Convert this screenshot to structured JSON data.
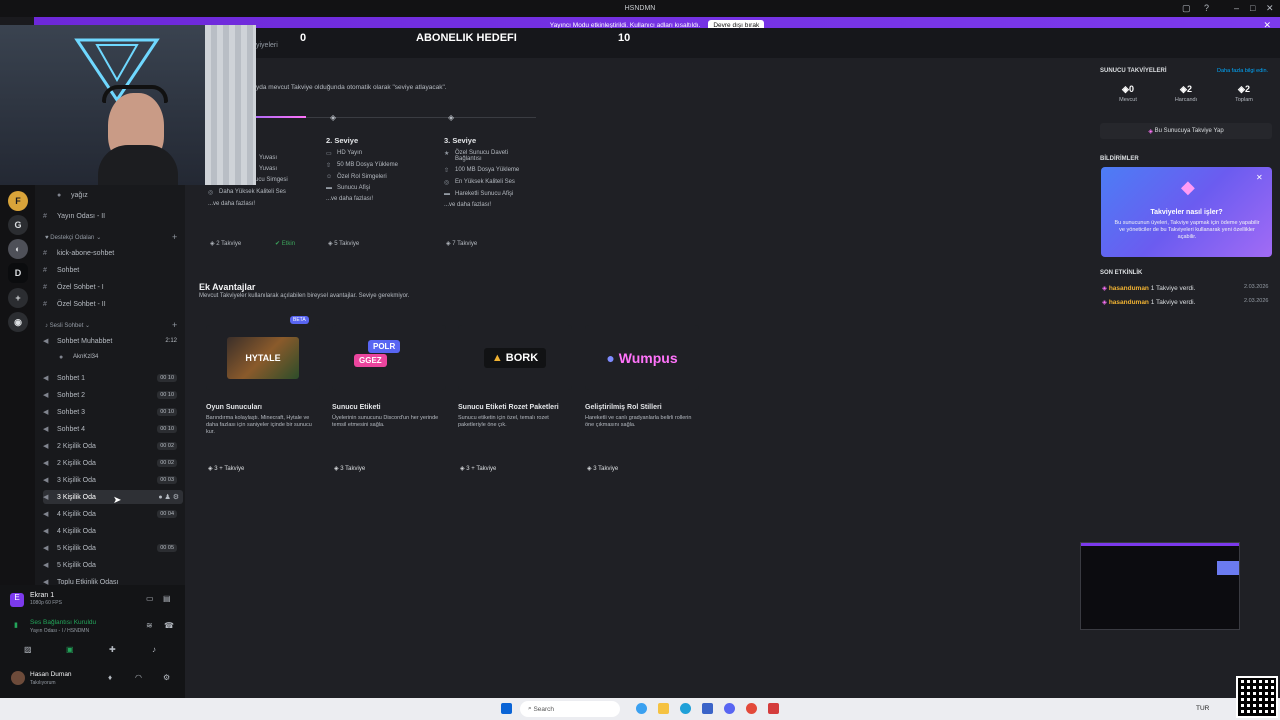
{
  "window": {
    "title": "HSNDMN"
  },
  "streamer_bar": {
    "message": "Yayıncı Modu etkinleştirildi. Kullanıcı adları kısaltıldı.",
    "button": "Devre dışı bırak"
  },
  "goal": {
    "left": "0",
    "title": "ABONELIK HEDEFI",
    "right": "10"
  },
  "header": {
    "partial_title": "yiyeleri",
    "note": "yda mevcut Takviye olduğunda otomatik olarak \"seviye atlayacak\"."
  },
  "tiers": [
    {
      "title": "",
      "items": [
        "Yuvası",
        "Yuvası",
        "Hareketli Sunucu Simgesi",
        "Daha Yüksek Kaliteli Ses",
        "...ve daha fazlası!"
      ],
      "cost": "2 Takviye",
      "status": "Etkin"
    },
    {
      "title": "2. Seviye",
      "items": [
        "HD Yayın",
        "50 MB Dosya Yükleme",
        "Özel Rol Simgeleri",
        "Sunucu Afişi",
        "...ve daha fazlası!"
      ],
      "cost": "5 Takviye"
    },
    {
      "title": "3. Seviye",
      "items": [
        "Özel Sunucu Daveti Bağlantısı",
        "100 MB Dosya Yükleme",
        "En Yüksek Kaliteli Ses",
        "Hareketli Sunucu Afişi",
        "...ve daha fazlası!"
      ],
      "cost": "7 Takviye"
    }
  ],
  "extra": {
    "title": "Ek Avantajlar",
    "subtitle": "Mevcut Takviyeler kullanılarak açılabilen bireysel avantajlar. Seviye gerekmiyor.",
    "beta": "BETA",
    "perks": [
      {
        "name": "Oyun Sunucuları",
        "desc": "Barındırma kolaylaştı. Minecraft, Hytale ve daha fazlası için saniyeler içinde bir sunucu kur.",
        "cost": "3 + Takviye",
        "art": "HYTALE"
      },
      {
        "name": "Sunucu Etiketi",
        "desc": "Üyelerinin sunucunu Discord'un her yerinde temsil etmesini sağla.",
        "cost": "3 Takviye",
        "art": "POLR",
        "art2": "GGEZ"
      },
      {
        "name": "Sunucu Etiketi Rozet Paketleri",
        "desc": "Sunucu etiketin için özel, temalı rozet paketleriyle öne çık.",
        "cost": "3 + Takviye",
        "art": "BORK"
      },
      {
        "name": "Geliştirilmiş Rol Stilleri",
        "desc": "Hareketli ve canlı gradyanlarla belirli rollerin öne çıkmasını sağla.",
        "cost": "3 Takviye",
        "art": "Wumpus"
      }
    ]
  },
  "right_panel": {
    "boosts_title": "SUNUCU TAKVİYELERİ",
    "learn_more": "Daha fazla bilgi edin.",
    "stats": [
      {
        "value": "0",
        "label": "Mevcut"
      },
      {
        "value": "2",
        "label": "Harcandı"
      },
      {
        "value": "2",
        "label": "Toplam"
      }
    ],
    "boost_button": "Bu Sunucuya Takviye Yap",
    "notif_title": "BİLDİRİMLER",
    "notif_card_title": "Takviyeler nasıl işler?",
    "notif_card_body": "Bu sunucunun üyeleri, Takviye yapmak için ödeme yapabilir ve yöneticiler de bu Takviyeleri kullanarak yeni özellikler açabilir.",
    "activity_title": "SON ETKİNLİK",
    "activity": [
      {
        "user": "hasanduman",
        "text": "1 Takviye verdi.",
        "date": "2.03.2026"
      },
      {
        "user": "hasanduman",
        "text": "1 Takviye verdi.",
        "date": "2.03.2026"
      }
    ]
  },
  "sidebar": {
    "top_user": "yağız",
    "channels_a": [
      {
        "label": "Yayın Odası - II",
        "icon": "#"
      }
    ],
    "cat1": "Destekçi Odaları",
    "channels_b": [
      {
        "label": "kick-abone-sohbet",
        "icon": "#"
      },
      {
        "label": "Sohbet",
        "icon": "#"
      },
      {
        "label": "Özel Sohbet - I",
        "icon": "#"
      },
      {
        "label": "Özel Sohbet - II",
        "icon": "#"
      }
    ],
    "cat2": "Sesli Sohbet",
    "voice_main": {
      "label": "Sohbet Muhabbet",
      "time": "2:12",
      "member": "AknKzl34"
    },
    "voice": [
      {
        "label": "Sohbet 1",
        "count": "00  10"
      },
      {
        "label": "Sohbet 2",
        "count": "00  10"
      },
      {
        "label": "Sohbet 3",
        "count": "00  10"
      },
      {
        "label": "Sohbet 4",
        "count": "00  10"
      },
      {
        "label": "2 Kişilik Oda",
        "count": "00  02"
      },
      {
        "label": "2 Kişilik Oda",
        "count": "00  02"
      },
      {
        "label": "3 Kişilik Oda",
        "count": "00  03"
      },
      {
        "label": "3 Kişilik Oda",
        "count": ""
      },
      {
        "label": "4 Kişilik Oda",
        "count": "00  04"
      },
      {
        "label": "4 Kişilik Oda",
        "count": ""
      },
      {
        "label": "5 Kişilik Oda",
        "count": "00  05"
      },
      {
        "label": "5 Kişilik Oda",
        "count": ""
      },
      {
        "label": "Toplu Etkinlik Odası",
        "count": ""
      }
    ]
  },
  "userbar": {
    "screen_title": "Ekran 1",
    "screen_sub": "1080p 60 FPS",
    "voice_status": "Ses Bağlantısı Kuruldu",
    "voice_sub": "Yayın Odası - I / HSNDMN",
    "username": "Hasan Duman",
    "user_status": "Takılıyorum"
  },
  "taskbar": {
    "search": "Search",
    "lang": "TUR"
  }
}
